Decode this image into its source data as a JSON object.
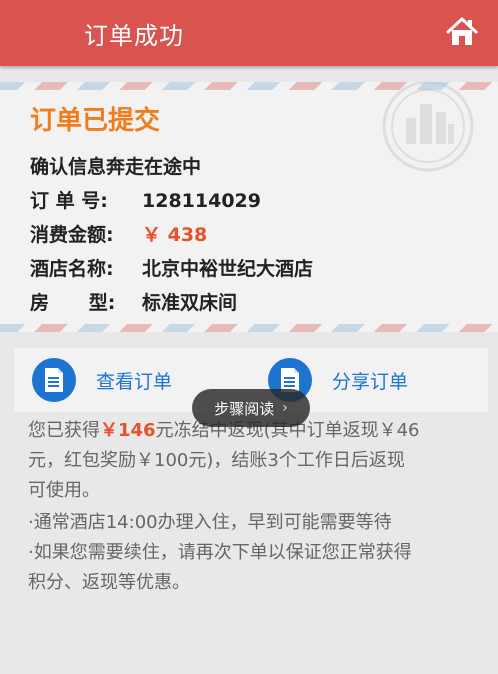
{
  "header": {
    "title": "订单成功",
    "icon": "home-icon",
    "color": "#d9534f"
  },
  "card": {
    "heading": "订单已提交",
    "subtitle": "确认信息奔走在途中",
    "rows": [
      {
        "label": "订 单 号:",
        "value": "128114029"
      },
      {
        "label": "消费金额:",
        "value": "￥ 438"
      },
      {
        "label": "房      型:",
        "value": "标准双床间"
      },
      {
        "label": "酒店名称:",
        "value": "北京中裕世纪大酒店"
      }
    ]
  },
  "actions": {
    "view_label": "查看订单",
    "share_label": "分享订单",
    "icon": "document-icon",
    "color": "#1e75d1"
  },
  "info": {
    "reward_prefix": "您已获得",
    "reward_amount": "￥146",
    "reward_rest_1": "元冻结中返现(其中订单返现￥46",
    "reward_rest_2": "元，红包奖励￥100元)，结账3个工作日后返现",
    "reward_rest_3": "可使用。",
    "note1": "·通常酒店14:00办理入住，早到可能需要等待",
    "note2_line1": "·如果您需要续住，请再次下单以保证您正常获得",
    "note2_line2": "积分、返现等优惠。"
  },
  "toast": {
    "label": "步骤阅读"
  }
}
